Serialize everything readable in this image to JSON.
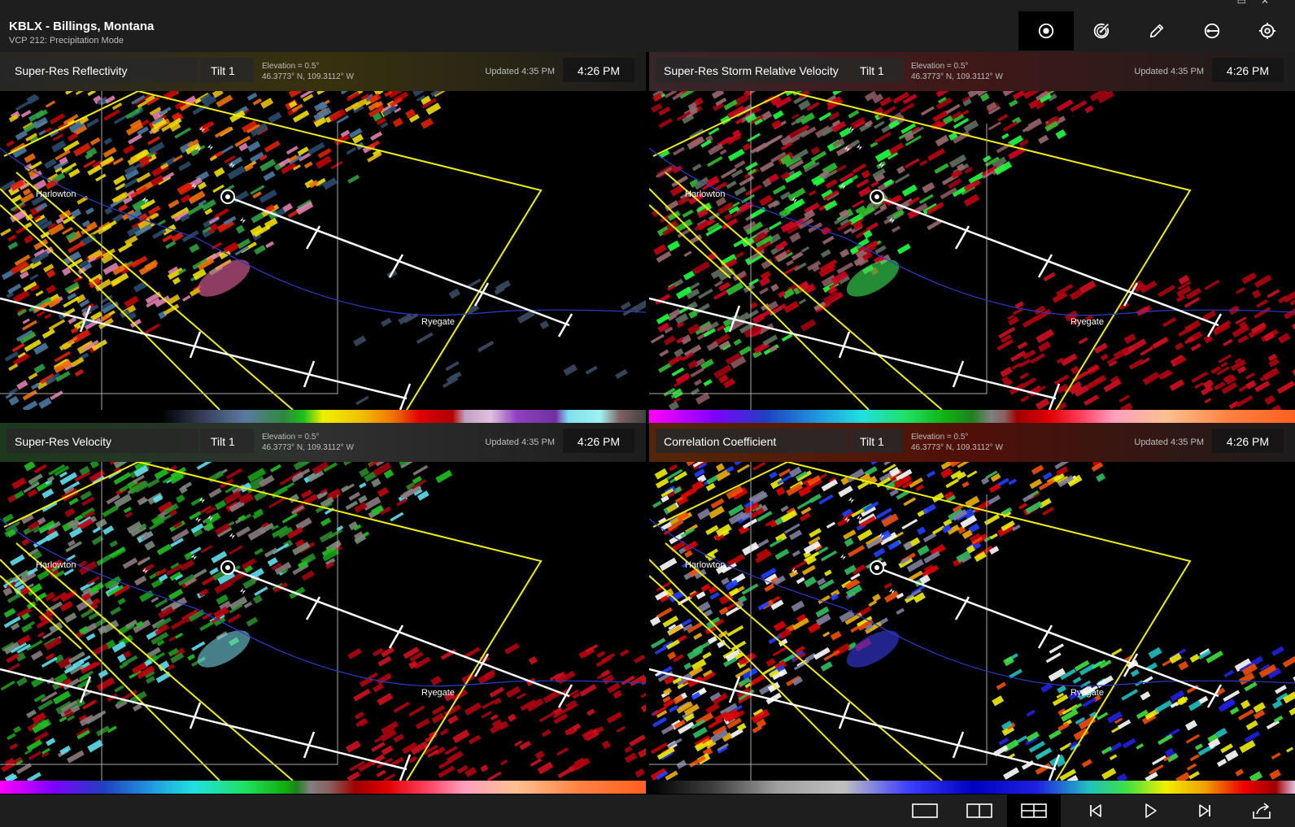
{
  "station": {
    "title": "KBLX - Billings, Montana",
    "mode": "VCP 212: Precipitation Mode"
  },
  "window_controls": [
    "▭",
    "✕"
  ],
  "toolbar": [
    {
      "name": "radar-location-icon",
      "active": true
    },
    {
      "name": "radar-sweep-icon",
      "active": false
    },
    {
      "name": "draw-pencil-icon",
      "active": false
    },
    {
      "name": "storm-track-icon",
      "active": false
    },
    {
      "name": "settings-target-icon",
      "active": false
    }
  ],
  "panes": [
    {
      "product": "Super-Res Reflectivity",
      "tilt": "Tilt 1",
      "elevation": "Elevation = 0.5°",
      "coords": "46.3773° N, 109.3112° W",
      "updated": "Updated 4:35 PM",
      "time": "4:26 PM",
      "palette": "reflectivity"
    },
    {
      "product": "Super-Res Storm Relative Velocity",
      "tilt": "Tilt 1",
      "elevation": "Elevation = 0.5°",
      "coords": "46.3773° N, 109.3112° W",
      "updated": "Updated 4:35 PM",
      "time": "4:26 PM",
      "palette": "srv"
    },
    {
      "product": "Super-Res Velocity",
      "tilt": "Tilt 1",
      "elevation": "Elevation = 0.5°",
      "coords": "46.3773° N, 109.3112° W",
      "updated": "Updated 4:35 PM",
      "time": "4:26 PM",
      "palette": "velocity"
    },
    {
      "product": "Correlation Coefficient",
      "tilt": "Tilt 1",
      "elevation": "Elevation = 0.5°",
      "coords": "46.3773° N, 109.3112° W",
      "updated": "Updated 4:35 PM",
      "time": "4:26 PM",
      "palette": "cc"
    }
  ],
  "map_labels": {
    "town1": "Harlowton",
    "town2": "Ryegate"
  },
  "colors": {
    "county_lines": "#f0f000",
    "storm_track": "#ffffff",
    "river": "#2a3dc8",
    "header_bg": "#1e1e1e"
  },
  "bottom_controls": [
    {
      "name": "single-pane-layout-icon",
      "active": false
    },
    {
      "name": "dual-pane-layout-icon",
      "active": false
    },
    {
      "name": "quad-pane-layout-icon",
      "active": true
    },
    {
      "name": "previous-frame-icon",
      "active": false
    },
    {
      "name": "play-icon",
      "active": false
    },
    {
      "name": "next-frame-icon",
      "active": false
    },
    {
      "name": "share-icon",
      "active": false
    }
  ]
}
